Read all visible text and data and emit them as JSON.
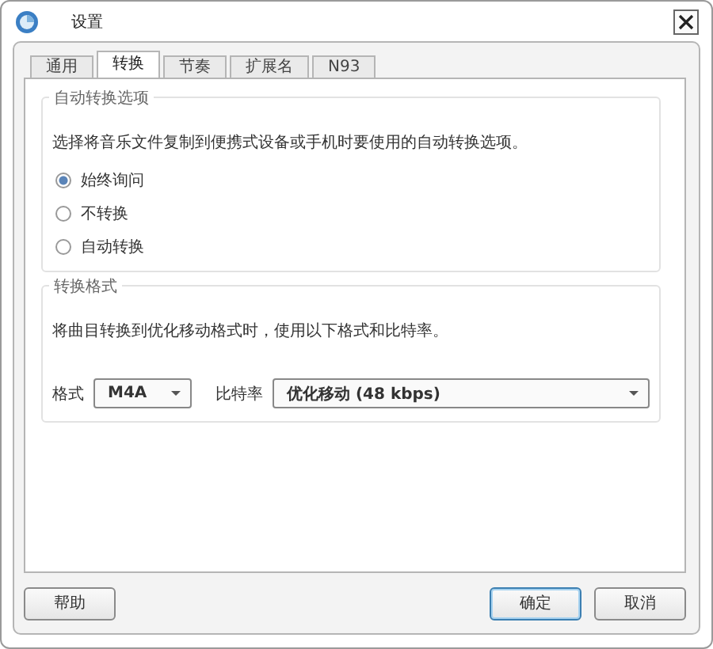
{
  "window": {
    "title": "设置"
  },
  "tabs": [
    {
      "label": "通用",
      "selected": false
    },
    {
      "label": "转换",
      "selected": true
    },
    {
      "label": "节奏",
      "selected": false
    },
    {
      "label": "扩展名",
      "selected": false
    },
    {
      "label": "N93",
      "selected": false
    }
  ],
  "groups": [
    {
      "title": "自动转换选项",
      "description": "选择将音乐文件复制到便携式设备或手机时要使用的自动转换选项。",
      "options": [
        {
          "label": "始终询问",
          "selected": true
        },
        {
          "label": "不转换",
          "selected": false
        },
        {
          "label": "自动转换",
          "selected": false
        }
      ]
    },
    {
      "title": "转换格式",
      "description": "将曲目转换到优化移动格式时，使用以下格式和比特率。",
      "dropdowns": [
        {
          "label": "格式",
          "value": "M4A"
        },
        {
          "label": "比特率",
          "value": "优化移动 (48 kbps)"
        }
      ]
    }
  ],
  "buttons": [
    {
      "label": "帮助",
      "kind": "left"
    },
    {
      "label": "确定",
      "kind": "default"
    },
    {
      "label": "取消",
      "kind": "normal"
    }
  ]
}
